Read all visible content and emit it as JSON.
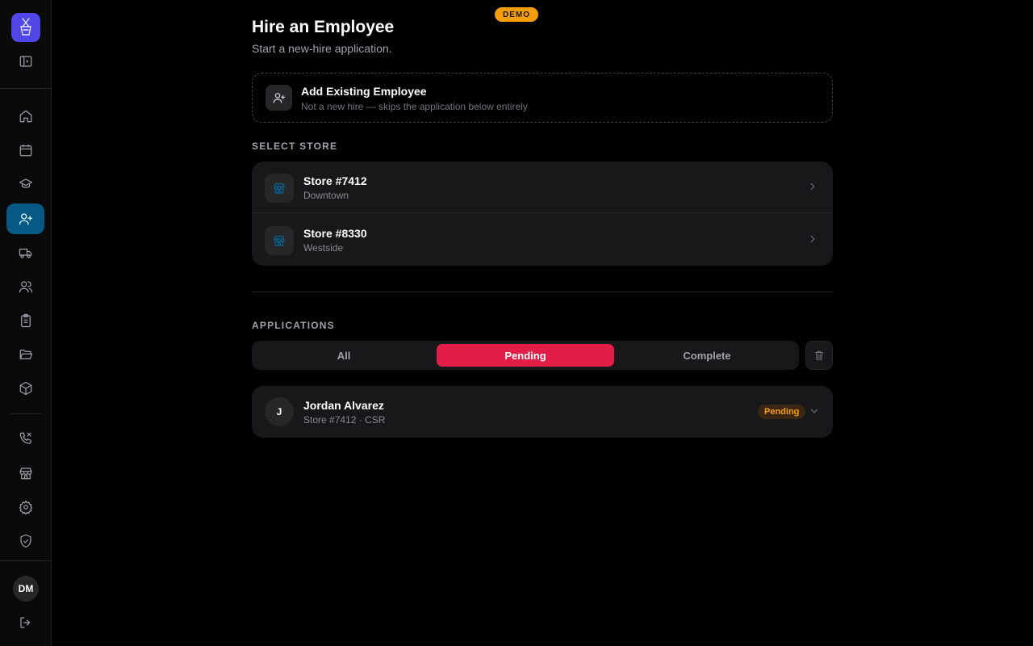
{
  "demo_badge": "DEMO",
  "sidebar": {
    "user_initials": "DM",
    "items": [
      {
        "icon": "home-icon"
      },
      {
        "icon": "calendar-icon"
      },
      {
        "icon": "graduation-cap-icon"
      },
      {
        "icon": "user-plus-icon",
        "active": true
      },
      {
        "icon": "truck-icon"
      },
      {
        "icon": "users-icon"
      },
      {
        "icon": "clipboard-icon"
      },
      {
        "icon": "folder-open-icon"
      },
      {
        "icon": "package-icon"
      },
      {
        "icon": "phone-x-icon"
      },
      {
        "icon": "store-icon"
      },
      {
        "icon": "settings-icon"
      },
      {
        "icon": "shield-check-icon"
      }
    ]
  },
  "header": {
    "title": "Hire an Employee",
    "subtitle": "Start a new-hire application."
  },
  "add_existing": {
    "title": "Add Existing Employee",
    "subtitle": "Not a new hire — skips the application below entirely"
  },
  "select_store": {
    "label": "SELECT STORE",
    "stores": [
      {
        "name": "Store #7412",
        "location": "Downtown"
      },
      {
        "name": "Store #8330",
        "location": "Westside"
      }
    ]
  },
  "applications": {
    "label": "APPLICATIONS",
    "tabs": [
      {
        "label": "All"
      },
      {
        "label": "Pending",
        "active": true
      },
      {
        "label": "Complete"
      }
    ],
    "items": [
      {
        "initial": "J",
        "name": "Jordan Alvarez",
        "meta": "Store #7412 · CSR",
        "status": "Pending"
      }
    ]
  },
  "colors": {
    "active_nav": "#075985",
    "active_tab": "#e11d48",
    "demo_badge": "#f59e0b",
    "pending_badge_text": "#f59e0b"
  }
}
